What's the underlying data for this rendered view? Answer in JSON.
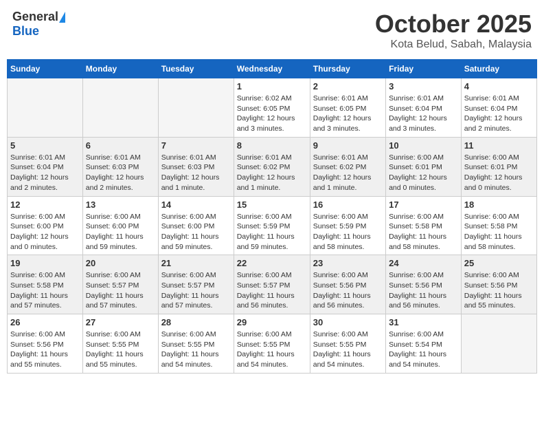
{
  "logo": {
    "general": "General",
    "blue": "Blue"
  },
  "header": {
    "month": "October 2025",
    "location": "Kota Belud, Sabah, Malaysia"
  },
  "weekdays": [
    "Sunday",
    "Monday",
    "Tuesday",
    "Wednesday",
    "Thursday",
    "Friday",
    "Saturday"
  ],
  "weeks": [
    [
      {
        "day": "",
        "info": ""
      },
      {
        "day": "",
        "info": ""
      },
      {
        "day": "",
        "info": ""
      },
      {
        "day": "1",
        "info": "Sunrise: 6:02 AM\nSunset: 6:05 PM\nDaylight: 12 hours and 3 minutes."
      },
      {
        "day": "2",
        "info": "Sunrise: 6:01 AM\nSunset: 6:05 PM\nDaylight: 12 hours and 3 minutes."
      },
      {
        "day": "3",
        "info": "Sunrise: 6:01 AM\nSunset: 6:04 PM\nDaylight: 12 hours and 3 minutes."
      },
      {
        "day": "4",
        "info": "Sunrise: 6:01 AM\nSunset: 6:04 PM\nDaylight: 12 hours and 2 minutes."
      }
    ],
    [
      {
        "day": "5",
        "info": "Sunrise: 6:01 AM\nSunset: 6:04 PM\nDaylight: 12 hours and 2 minutes."
      },
      {
        "day": "6",
        "info": "Sunrise: 6:01 AM\nSunset: 6:03 PM\nDaylight: 12 hours and 2 minutes."
      },
      {
        "day": "7",
        "info": "Sunrise: 6:01 AM\nSunset: 6:03 PM\nDaylight: 12 hours and 1 minute."
      },
      {
        "day": "8",
        "info": "Sunrise: 6:01 AM\nSunset: 6:02 PM\nDaylight: 12 hours and 1 minute."
      },
      {
        "day": "9",
        "info": "Sunrise: 6:01 AM\nSunset: 6:02 PM\nDaylight: 12 hours and 1 minute."
      },
      {
        "day": "10",
        "info": "Sunrise: 6:00 AM\nSunset: 6:01 PM\nDaylight: 12 hours and 0 minutes."
      },
      {
        "day": "11",
        "info": "Sunrise: 6:00 AM\nSunset: 6:01 PM\nDaylight: 12 hours and 0 minutes."
      }
    ],
    [
      {
        "day": "12",
        "info": "Sunrise: 6:00 AM\nSunset: 6:00 PM\nDaylight: 12 hours and 0 minutes."
      },
      {
        "day": "13",
        "info": "Sunrise: 6:00 AM\nSunset: 6:00 PM\nDaylight: 11 hours and 59 minutes."
      },
      {
        "day": "14",
        "info": "Sunrise: 6:00 AM\nSunset: 6:00 PM\nDaylight: 11 hours and 59 minutes."
      },
      {
        "day": "15",
        "info": "Sunrise: 6:00 AM\nSunset: 5:59 PM\nDaylight: 11 hours and 59 minutes."
      },
      {
        "day": "16",
        "info": "Sunrise: 6:00 AM\nSunset: 5:59 PM\nDaylight: 11 hours and 58 minutes."
      },
      {
        "day": "17",
        "info": "Sunrise: 6:00 AM\nSunset: 5:58 PM\nDaylight: 11 hours and 58 minutes."
      },
      {
        "day": "18",
        "info": "Sunrise: 6:00 AM\nSunset: 5:58 PM\nDaylight: 11 hours and 58 minutes."
      }
    ],
    [
      {
        "day": "19",
        "info": "Sunrise: 6:00 AM\nSunset: 5:58 PM\nDaylight: 11 hours and 57 minutes."
      },
      {
        "day": "20",
        "info": "Sunrise: 6:00 AM\nSunset: 5:57 PM\nDaylight: 11 hours and 57 minutes."
      },
      {
        "day": "21",
        "info": "Sunrise: 6:00 AM\nSunset: 5:57 PM\nDaylight: 11 hours and 57 minutes."
      },
      {
        "day": "22",
        "info": "Sunrise: 6:00 AM\nSunset: 5:57 PM\nDaylight: 11 hours and 56 minutes."
      },
      {
        "day": "23",
        "info": "Sunrise: 6:00 AM\nSunset: 5:56 PM\nDaylight: 11 hours and 56 minutes."
      },
      {
        "day": "24",
        "info": "Sunrise: 6:00 AM\nSunset: 5:56 PM\nDaylight: 11 hours and 56 minutes."
      },
      {
        "day": "25",
        "info": "Sunrise: 6:00 AM\nSunset: 5:56 PM\nDaylight: 11 hours and 55 minutes."
      }
    ],
    [
      {
        "day": "26",
        "info": "Sunrise: 6:00 AM\nSunset: 5:56 PM\nDaylight: 11 hours and 55 minutes."
      },
      {
        "day": "27",
        "info": "Sunrise: 6:00 AM\nSunset: 5:55 PM\nDaylight: 11 hours and 55 minutes."
      },
      {
        "day": "28",
        "info": "Sunrise: 6:00 AM\nSunset: 5:55 PM\nDaylight: 11 hours and 54 minutes."
      },
      {
        "day": "29",
        "info": "Sunrise: 6:00 AM\nSunset: 5:55 PM\nDaylight: 11 hours and 54 minutes."
      },
      {
        "day": "30",
        "info": "Sunrise: 6:00 AM\nSunset: 5:55 PM\nDaylight: 11 hours and 54 minutes."
      },
      {
        "day": "31",
        "info": "Sunrise: 6:00 AM\nSunset: 5:54 PM\nDaylight: 11 hours and 54 minutes."
      },
      {
        "day": "",
        "info": ""
      }
    ]
  ]
}
